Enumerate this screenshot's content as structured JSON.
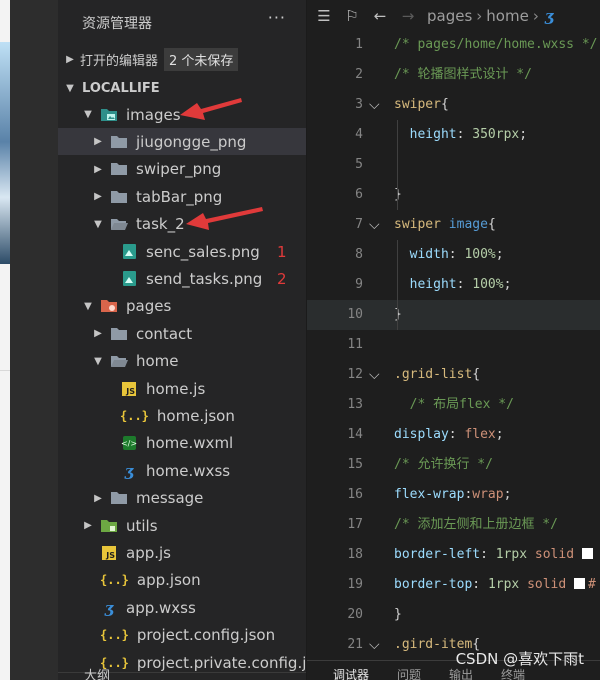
{
  "explorer": {
    "title": "资源管理器",
    "more": "···",
    "open_editors": {
      "label": "打开的编辑器",
      "badge": "2 个未保存"
    },
    "project_name": "LOCALLIFE",
    "tree": [
      {
        "name": "images",
        "kind": "folder-img",
        "twisty": "open",
        "depth": 1
      },
      {
        "name": "jiugongge_png",
        "kind": "folder",
        "twisty": "closed",
        "depth": 2,
        "selected": true
      },
      {
        "name": "swiper_png",
        "kind": "folder",
        "twisty": "closed",
        "depth": 2
      },
      {
        "name": "tabBar_png",
        "kind": "folder",
        "twisty": "closed",
        "depth": 2
      },
      {
        "name": "task_2",
        "kind": "folder-open",
        "twisty": "open",
        "depth": 2
      },
      {
        "name": "senc_sales.png",
        "kind": "png",
        "twisty": "none",
        "depth": 3,
        "annotation": "1"
      },
      {
        "name": "send_tasks.png",
        "kind": "png",
        "twisty": "none",
        "depth": 3,
        "annotation": "2"
      },
      {
        "name": "pages",
        "kind": "folder-pages",
        "twisty": "open",
        "depth": 1
      },
      {
        "name": "contact",
        "kind": "folder",
        "twisty": "closed",
        "depth": 2
      },
      {
        "name": "home",
        "kind": "folder-open",
        "twisty": "open",
        "depth": 2
      },
      {
        "name": "home.js",
        "kind": "js",
        "twisty": "none",
        "depth": 3
      },
      {
        "name": "home.json",
        "kind": "json",
        "twisty": "none",
        "depth": 3
      },
      {
        "name": "home.wxml",
        "kind": "wxml",
        "twisty": "none",
        "depth": 3
      },
      {
        "name": "home.wxss",
        "kind": "wxss",
        "twisty": "none",
        "depth": 3
      },
      {
        "name": "message",
        "kind": "folder",
        "twisty": "closed",
        "depth": 2
      },
      {
        "name": "utils",
        "kind": "folder-utils",
        "twisty": "closed",
        "depth": 1
      },
      {
        "name": "app.js",
        "kind": "js",
        "twisty": "none",
        "depth": 1
      },
      {
        "name": "app.json",
        "kind": "json",
        "twisty": "none",
        "depth": 1
      },
      {
        "name": "app.wxss",
        "kind": "wxss",
        "twisty": "none",
        "depth": 1
      },
      {
        "name": "project.config.json",
        "kind": "json",
        "twisty": "none",
        "depth": 1
      },
      {
        "name": "project.private.config.json",
        "kind": "json",
        "twisty": "none",
        "depth": 1
      }
    ],
    "bottom_section": "大纲"
  },
  "editor": {
    "breadcrumb": [
      "pages",
      "home"
    ],
    "code": [
      {
        "n": "1",
        "fold": "",
        "tokens": [
          [
            "c-cm",
            "/* pages/home/home.wxss */"
          ]
        ]
      },
      {
        "n": "2",
        "fold": "",
        "tokens": [
          [
            "c-cm",
            "/* 轮播图样式设计 */"
          ]
        ]
      },
      {
        "n": "3",
        "fold": "open",
        "tokens": [
          [
            "c-sel",
            "swiper"
          ],
          [
            "c-br",
            "{"
          ]
        ]
      },
      {
        "n": "4",
        "fold": "",
        "tokens": [
          [
            "c-p",
            "  "
          ],
          [
            "c-prop",
            "height"
          ],
          [
            "c-p",
            ": "
          ],
          [
            "c-num",
            "350"
          ],
          [
            "c-num",
            "rpx"
          ],
          [
            "c-p",
            ";"
          ]
        ]
      },
      {
        "n": "5",
        "fold": "",
        "tokens": []
      },
      {
        "n": "6",
        "fold": "",
        "tokens": [
          [
            "c-br",
            "}"
          ]
        ]
      },
      {
        "n": "7",
        "fold": "open",
        "tokens": [
          [
            "c-sel",
            "swiper "
          ],
          [
            "c-tag",
            "image"
          ],
          [
            "c-br",
            "{"
          ]
        ]
      },
      {
        "n": "8",
        "fold": "",
        "tokens": [
          [
            "c-p",
            "  "
          ],
          [
            "c-prop",
            "width"
          ],
          [
            "c-p",
            ": "
          ],
          [
            "c-num",
            "100%"
          ],
          [
            "c-p",
            ";"
          ]
        ]
      },
      {
        "n": "9",
        "fold": "",
        "tokens": [
          [
            "c-p",
            "  "
          ],
          [
            "c-prop",
            "height"
          ],
          [
            "c-p",
            ": "
          ],
          [
            "c-num",
            "100%"
          ],
          [
            "c-p",
            ";"
          ]
        ]
      },
      {
        "n": "10",
        "fold": "",
        "hl": true,
        "tokens": [
          [
            "c-br",
            "}"
          ]
        ]
      },
      {
        "n": "11",
        "fold": "",
        "tokens": []
      },
      {
        "n": "12",
        "fold": "open",
        "tokens": [
          [
            "c-sel",
            ".grid-list"
          ],
          [
            "c-br",
            "{"
          ]
        ]
      },
      {
        "n": "13",
        "fold": "",
        "tokens": [
          [
            "c-p",
            "  "
          ],
          [
            "c-cm",
            "/* 布局flex */"
          ]
        ]
      },
      {
        "n": "14",
        "fold": "",
        "tokens": [
          [
            "c-prop",
            "display"
          ],
          [
            "c-p",
            ": "
          ],
          [
            "c-val",
            "flex"
          ],
          [
            "c-p",
            ";"
          ]
        ]
      },
      {
        "n": "15",
        "fold": "",
        "tokens": [
          [
            "c-cm",
            "/* 允许换行 */"
          ]
        ]
      },
      {
        "n": "16",
        "fold": "",
        "tokens": [
          [
            "c-prop",
            "flex-wrap"
          ],
          [
            "c-p",
            ":"
          ],
          [
            "c-val",
            "wrap"
          ],
          [
            "c-p",
            ";"
          ]
        ]
      },
      {
        "n": "17",
        "fold": "",
        "tokens": [
          [
            "c-cm",
            "/* 添加左侧和上册边框 */"
          ]
        ]
      },
      {
        "n": "18",
        "fold": "",
        "tokens": [
          [
            "c-prop",
            "border-left"
          ],
          [
            "c-p",
            ": "
          ],
          [
            "c-num",
            "1rpx"
          ],
          [
            "c-p",
            " "
          ],
          [
            "c-val",
            "solid"
          ],
          [
            "c-p",
            " "
          ],
          [
            "swatch",
            ""
          ]
        ]
      },
      {
        "n": "19",
        "fold": "",
        "tokens": [
          [
            "c-prop",
            "border-top"
          ],
          [
            "c-p",
            ": "
          ],
          [
            "c-num",
            "1rpx"
          ],
          [
            "c-p",
            " "
          ],
          [
            "c-val",
            "solid"
          ],
          [
            "c-p",
            " "
          ],
          [
            "swatch",
            ""
          ],
          [
            "c-val",
            "#"
          ]
        ]
      },
      {
        "n": "20",
        "fold": "",
        "tokens": [
          [
            "c-br",
            "}"
          ]
        ]
      },
      {
        "n": "21",
        "fold": "open",
        "tokens": [
          [
            "c-sel",
            ".gird-item"
          ],
          [
            "c-br",
            "{"
          ]
        ]
      }
    ],
    "panel_tabs": [
      "调试器",
      "问题",
      "输出",
      "终端"
    ]
  },
  "watermark": "CSDN @喜欢下雨t",
  "colors": {
    "annotation_red": "#e03a3a",
    "selection": "#37373d"
  }
}
